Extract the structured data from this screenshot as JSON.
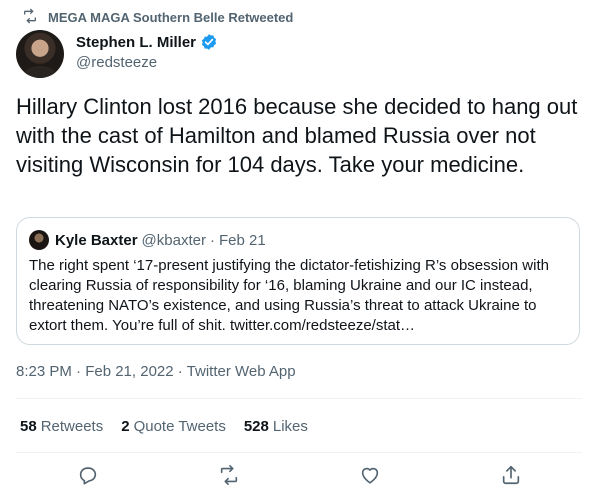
{
  "retweet_context": {
    "text": "MEGA MAGA Southern Belle Retweeted",
    "icon": "retweet-icon"
  },
  "author": {
    "display_name": "Stephen L. Miller",
    "handle": "@redsteeze",
    "verified": true,
    "verified_color": "#1d9bf0"
  },
  "tweet": {
    "text": "Hillary Clinton lost 2016 because she decided to hang out with the cast of Hamilton and blamed Russia over not visiting Wisconsin for 104 days. Take your medicine."
  },
  "quote": {
    "display_name": "Kyle Baxter",
    "handle": "@kbaxter",
    "separator": "·",
    "date": "Feb 21",
    "text": "The right spent ‘17-present justifying the dictator-fetishizing R’s obsession with clearing Russia of responsibility for ‘16, blaming Ukraine and our IC instead, threatening NATO’s existence, and using Russia’s threat to attack Ukraine to extort them. You’re full of shit. twitter.com/redsteeze/stat…"
  },
  "meta": {
    "timestamp": "8:23 PM · Feb 21, 2022 · Twitter Web App"
  },
  "stats": {
    "retweets": {
      "count": "58",
      "label": "Retweets"
    },
    "quote_tweets": {
      "count": "2",
      "label": "Quote Tweets"
    },
    "likes": {
      "count": "528",
      "label": "Likes"
    }
  },
  "actions": {
    "reply": "reply-icon",
    "retweet": "retweet-icon",
    "like": "heart-icon",
    "share": "share-icon"
  },
  "colors": {
    "text": "#0f1419",
    "secondary": "#536471",
    "border": "#cfd9de",
    "accent": "#1d9bf0"
  }
}
